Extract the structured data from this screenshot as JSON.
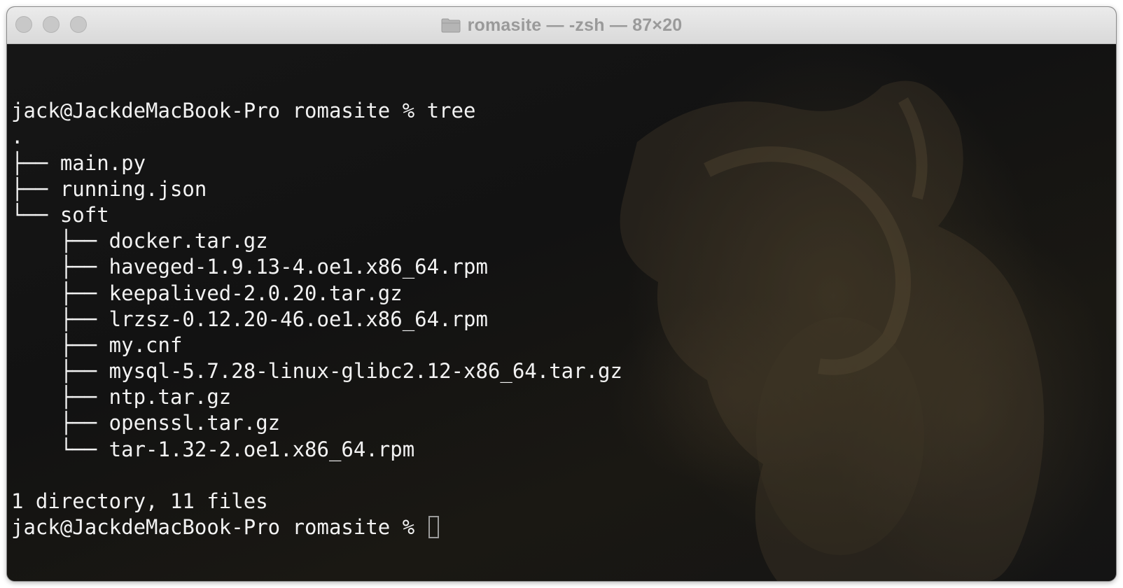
{
  "window": {
    "title": "romasite — -zsh — 87×20",
    "title_icon": "folder-icon"
  },
  "terminal": {
    "lines": [
      "",
      "jack@JackdeMacBook-Pro romasite % tree",
      ".",
      "├── main.py",
      "├── running.json",
      "└── soft",
      "    ├── docker.tar.gz",
      "    ├── haveged-1.9.13-4.oe1.x86_64.rpm",
      "    ├── keepalived-2.0.20.tar.gz",
      "    ├── lrzsz-0.12.20-46.oe1.x86_64.rpm",
      "    ├── my.cnf",
      "    ├── mysql-5.7.28-linux-glibc2.12-x86_64.tar.gz",
      "    ├── ntp.tar.gz",
      "    ├── openssl.tar.gz",
      "    └── tar-1.32-2.oe1.x86_64.rpm",
      "",
      "1 directory, 11 files"
    ],
    "prompt": "jack@JackdeMacBook-Pro romasite % "
  },
  "colors": {
    "text": "#f2f2f2",
    "titlebar": "#e3e3e3",
    "title_text": "#9a9a9a",
    "background": "#111111"
  }
}
